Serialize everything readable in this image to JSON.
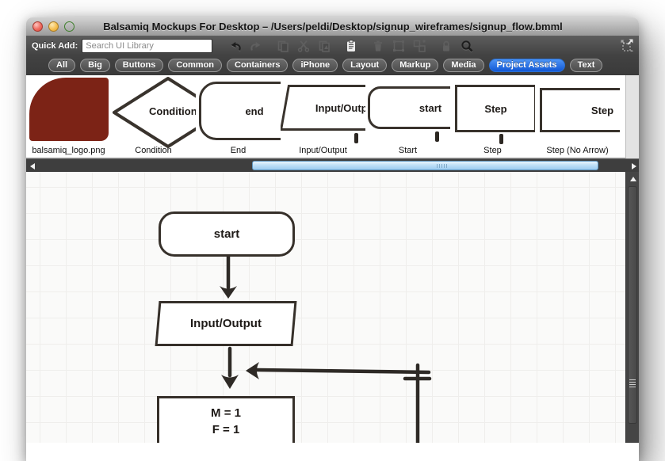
{
  "window": {
    "title": "Balsamiq Mockups For Desktop – /Users/peldi/Desktop/signup_wireframes/signup_flow.bmml"
  },
  "quick_add": {
    "label": "Quick Add:",
    "search_placeholder": "Search UI Library"
  },
  "toolbar_icons": [
    {
      "name": "undo",
      "state": "enabled"
    },
    {
      "name": "redo",
      "state": "disabled"
    },
    {
      "name": "copy",
      "state": "disabled"
    },
    {
      "name": "cut",
      "state": "disabled"
    },
    {
      "name": "duplicate",
      "state": "disabled"
    },
    {
      "name": "paste",
      "state": "highlighted"
    },
    {
      "name": "delete",
      "state": "disabled"
    },
    {
      "name": "group",
      "state": "disabled"
    },
    {
      "name": "ungroup",
      "state": "disabled"
    },
    {
      "name": "lock",
      "state": "disabled"
    },
    {
      "name": "zoom",
      "state": "enabled"
    }
  ],
  "tabs": {
    "items": [
      "All",
      "Big",
      "Buttons",
      "Common",
      "Containers",
      "iPhone",
      "Layout",
      "Markup",
      "Media",
      "Project Assets",
      "Text"
    ],
    "selected": "Project Assets"
  },
  "library": {
    "items": [
      {
        "label": "balsamiq_logo.png",
        "text": ""
      },
      {
        "label": "Condition",
        "text": "Condition"
      },
      {
        "label": "End",
        "text": "end"
      },
      {
        "label": "Input/Output",
        "text": "Input/Output"
      },
      {
        "label": "Start",
        "text": "start"
      },
      {
        "label": "Step",
        "text": "Step"
      },
      {
        "label": "Step (No Arrow)",
        "text": "Step"
      }
    ]
  },
  "canvas": {
    "nodes": {
      "start": "start",
      "io": "Input/Output",
      "m_line1": "M = 1",
      "m_line2": "F = 1"
    }
  },
  "colors": {
    "accent_blue": "#1a6fe8",
    "logo_red": "#7c2316",
    "ink": "#36302a",
    "scroll_thumb_blue": "#bfe0f7",
    "canvas_bg": "#fafaf9"
  }
}
